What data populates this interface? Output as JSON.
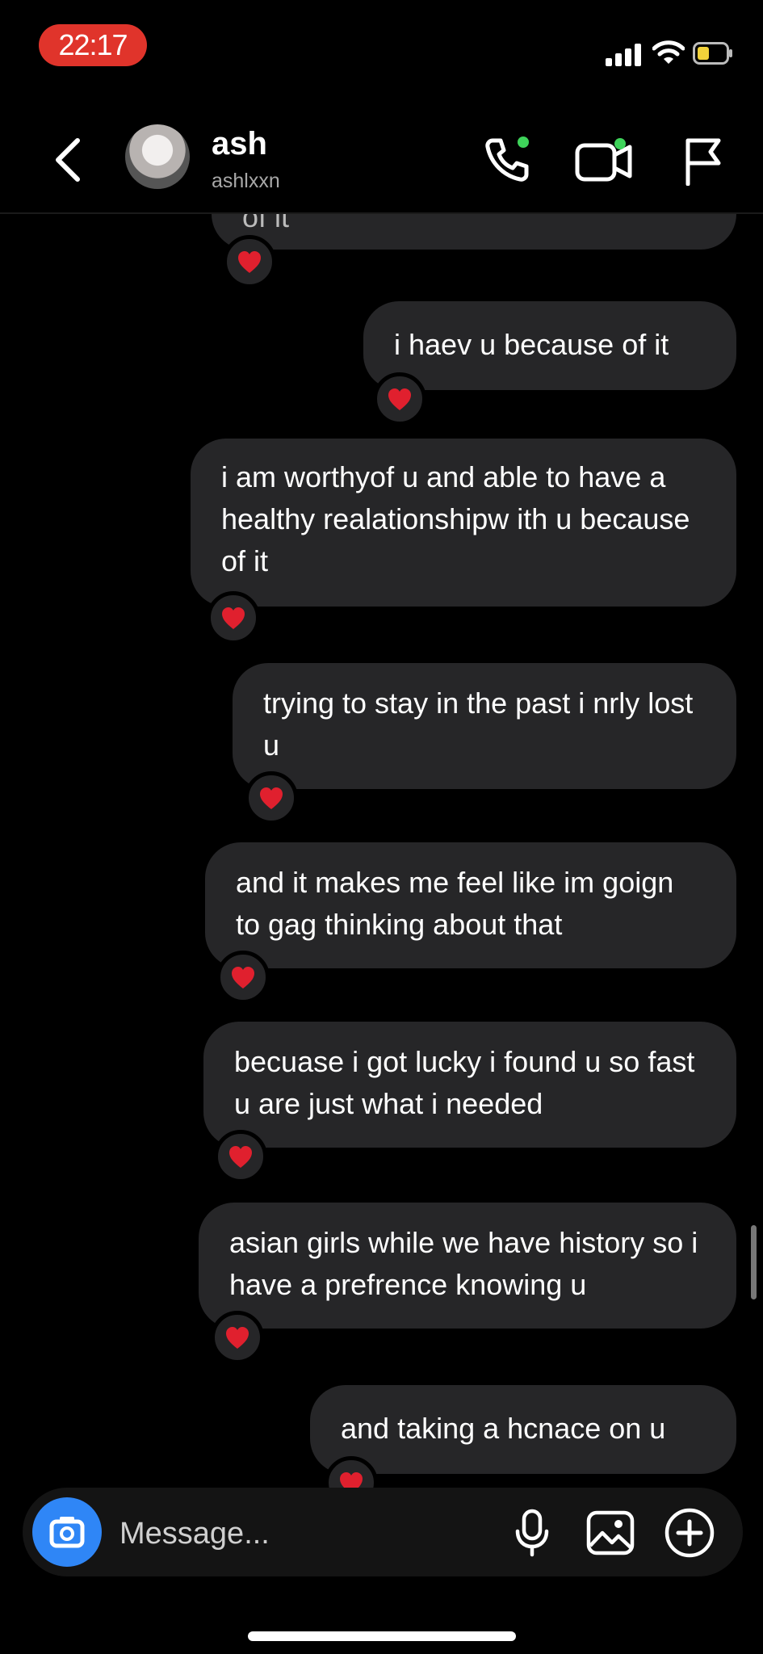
{
  "status_bar": {
    "time": "22:17",
    "time_pill_color": "#e0342b"
  },
  "header": {
    "name": "ash",
    "handle": "ashlxxn",
    "icons": [
      "back-arrow-icon",
      "phone-call-icon",
      "video-call-icon",
      "flag-icon"
    ]
  },
  "messages": [
    {
      "text": "of it",
      "reaction": "red-heart"
    },
    {
      "text": "i haev u because of it",
      "reaction": "red-heart"
    },
    {
      "text": "i am worthyof u and able to have a healthy realationshipw ith u because of it",
      "reaction": "red-heart"
    },
    {
      "text": "trying to stay in the past i nrly lost u",
      "reaction": "red-heart"
    },
    {
      "text": "and it makes me feel like im goign to gag thinking about that",
      "reaction": "red-heart"
    },
    {
      "text": "becuase i got lucky i found u so fast u are just what i needed",
      "reaction": "red-heart"
    },
    {
      "text": "asian girls while we have history so i have a prefrence knowing u",
      "reaction": "red-heart"
    },
    {
      "text": "and taking a hcnace on u",
      "reaction": "red-heart"
    }
  ],
  "composer": {
    "placeholder": "Message...",
    "icons": [
      "camera-icon",
      "microphone-icon",
      "gallery-icon",
      "add-icon"
    ],
    "camera_color": "#2f86f6"
  },
  "theme": {
    "bubble_color": "#262628",
    "background": "#000000",
    "heart_color": "#e0202e"
  }
}
